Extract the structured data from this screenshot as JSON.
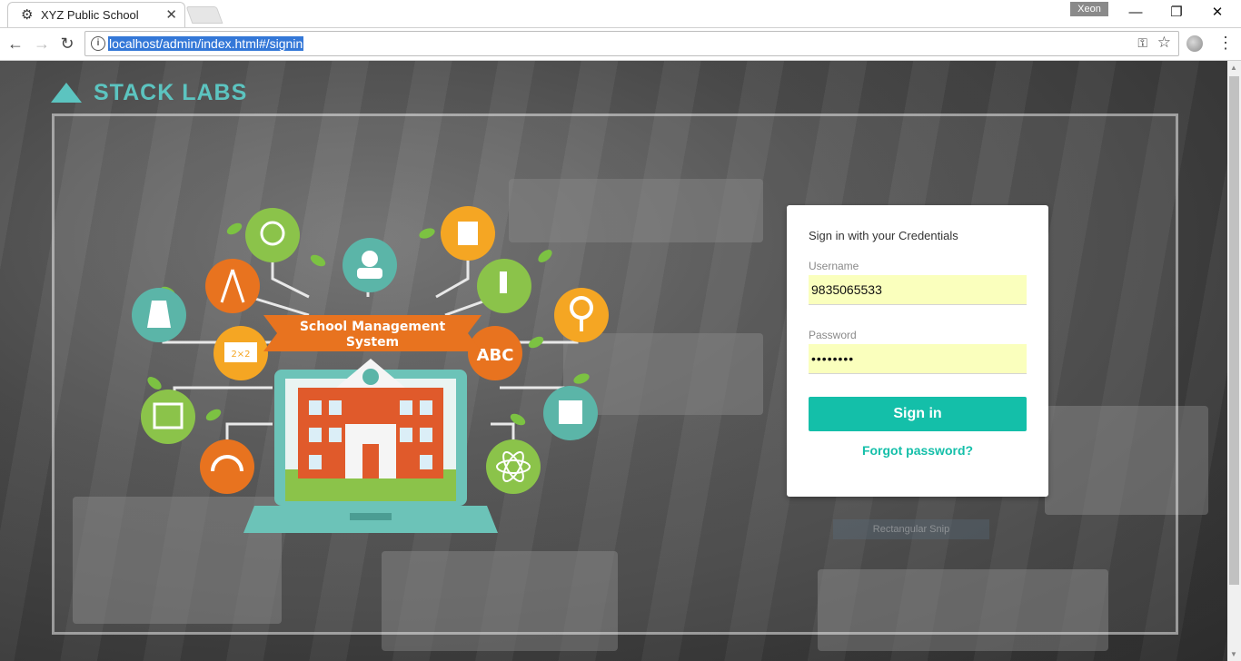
{
  "browser": {
    "tab_title": "XYZ Public School",
    "tab_close": "✕",
    "profile_name": "Xeon",
    "url": "localhost/admin/index.html#/signin",
    "window_controls": {
      "minimize": "—",
      "restore": "❐",
      "close": "✕"
    },
    "nav": {
      "back": "←",
      "forward": "→",
      "reload": "↻"
    }
  },
  "brand": {
    "name": "STACK LABS",
    "color": "#5cc4c0"
  },
  "illustration": {
    "banner_line1": "School Management",
    "banner_line2": "System",
    "badge_abc": "ABC",
    "badge_math": "2×2"
  },
  "signin": {
    "heading": "Sign in with your Credentials",
    "username_label": "Username",
    "username_value": "9835065533",
    "password_label": "Password",
    "password_value": "••••••••",
    "submit_label": "Sign in",
    "forgot_label": "Forgot password?",
    "accent": "#14bfa9",
    "autofill_bg": "#faffbd"
  },
  "overlay": {
    "snip_label": "Rectangular Snip"
  }
}
